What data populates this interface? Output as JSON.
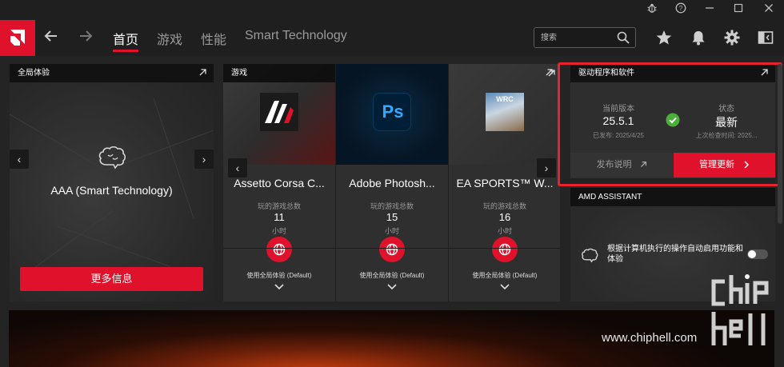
{
  "nav": {
    "tabs": [
      "首页",
      "游戏",
      "性能",
      "Smart Technology"
    ],
    "search_placeholder": "搜索"
  },
  "global_experience": {
    "title": "全局体验",
    "profile_name": "AAA (Smart Technology)",
    "more_info_label": "更多信息"
  },
  "games": {
    "title": "游戏",
    "played_label": "玩的游戏总数",
    "unit": "小时",
    "items": [
      {
        "title": "Assetto Corsa C...",
        "hours": "11",
        "profile": "使用全局体验 (Default)",
        "art_text": ""
      },
      {
        "title": "Adobe Photosh...",
        "hours": "15",
        "profile": "使用全局体验 (Default)",
        "art_text": "Ps"
      },
      {
        "title": "EA SPORTS™ W...",
        "hours": "16",
        "profile": "使用全局体验 (Default)",
        "art_text": "WRC"
      }
    ]
  },
  "driver": {
    "title": "驱动程序和软件",
    "current_version_label": "当前版本",
    "version": "25.5.1",
    "released": "已发布: 2025/4/25",
    "status_label": "状态",
    "status": "最新",
    "last_checked": "上次检查时间: 2025...",
    "release_notes_label": "发布说明",
    "manage_updates_label": "管理更新"
  },
  "assistant": {
    "title": "AMD ASSISTANT",
    "description": "根据计算机执行的操作自动启用功能和体验",
    "toggle_on": false
  },
  "watermark": {
    "site": "www.chiphell.com"
  },
  "colors": {
    "accent": "#e0122b",
    "success": "#4cae3a",
    "highlight": "#e8232f"
  }
}
